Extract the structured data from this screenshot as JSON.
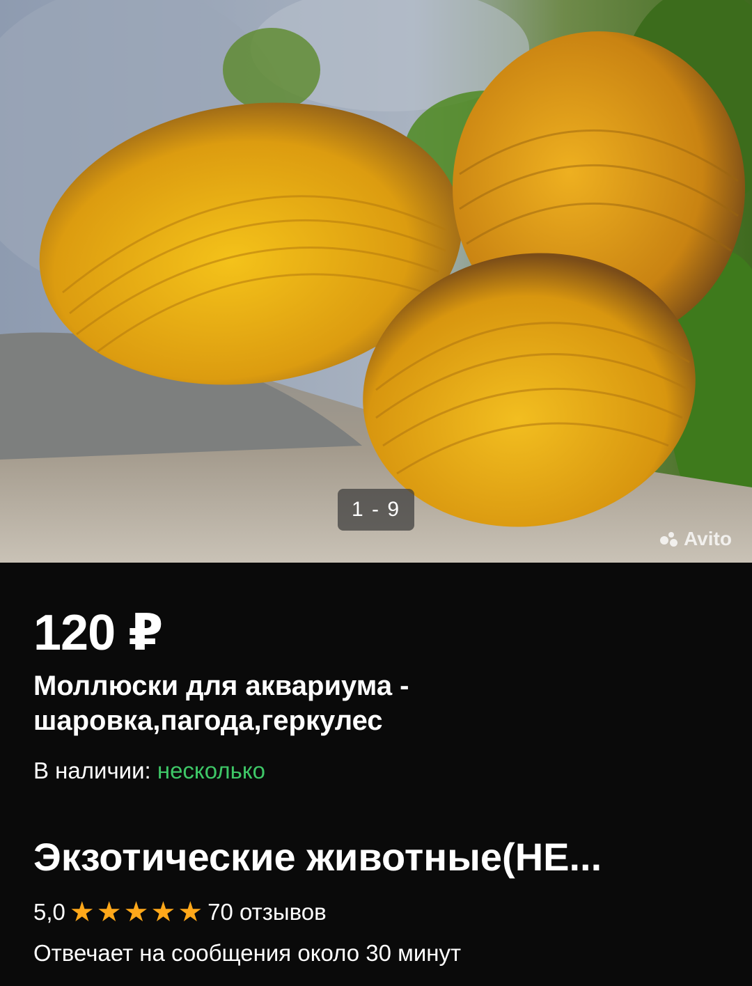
{
  "gallery": {
    "image_alt": "Моллюски для аквариума",
    "counter": "1 - 9",
    "watermark": "Avito"
  },
  "listing": {
    "price": "120 ₽",
    "title": "Моллюски для аквариума - шаровка,пагода,геркулес",
    "stock_label": "В наличии:",
    "stock_value": "несколько"
  },
  "seller": {
    "name": "Экзотические животные(НЕ...",
    "rating": "5,0",
    "stars": 5,
    "reviews": "70 отзывов",
    "response_time": "Отвечает на сообщения около 30 минут"
  },
  "colors": {
    "background": "#0a0a0a",
    "stock_green": "#3ec767",
    "star_orange": "#ffa81a"
  }
}
